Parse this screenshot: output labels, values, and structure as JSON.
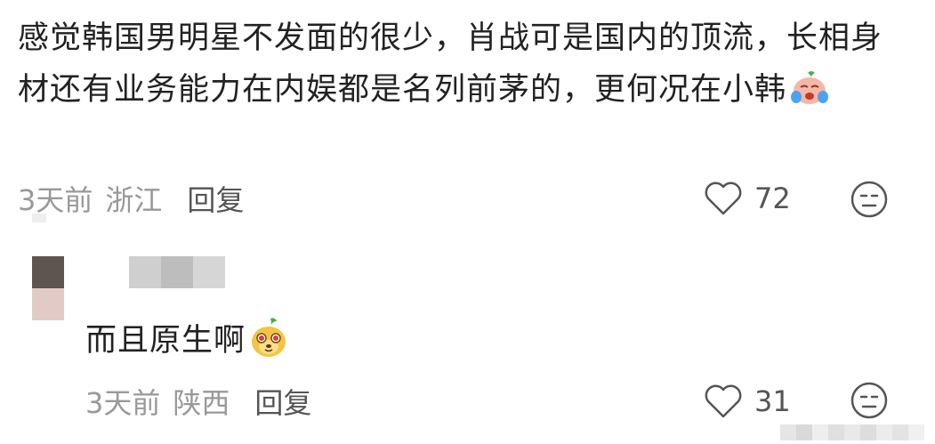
{
  "comment": {
    "text": "感觉韩国男明星不发面的很少，肖战可是国内的顶流，长相身材还有业务能力在内娱都是名列前茅的，更何况在小韩",
    "emoji": "crying-face-emoji",
    "time": "3天前",
    "location": "浙江",
    "reply_label": "回复",
    "like_count": "72",
    "colors": {
      "text": "#222222",
      "meta": "#999999",
      "icon": "#555555"
    }
  },
  "reply": {
    "text": "而且原生啊",
    "emoji": "dog-face-emoji",
    "time": "3天前",
    "location": "陕西",
    "reply_label": "回复",
    "like_count": "31"
  }
}
